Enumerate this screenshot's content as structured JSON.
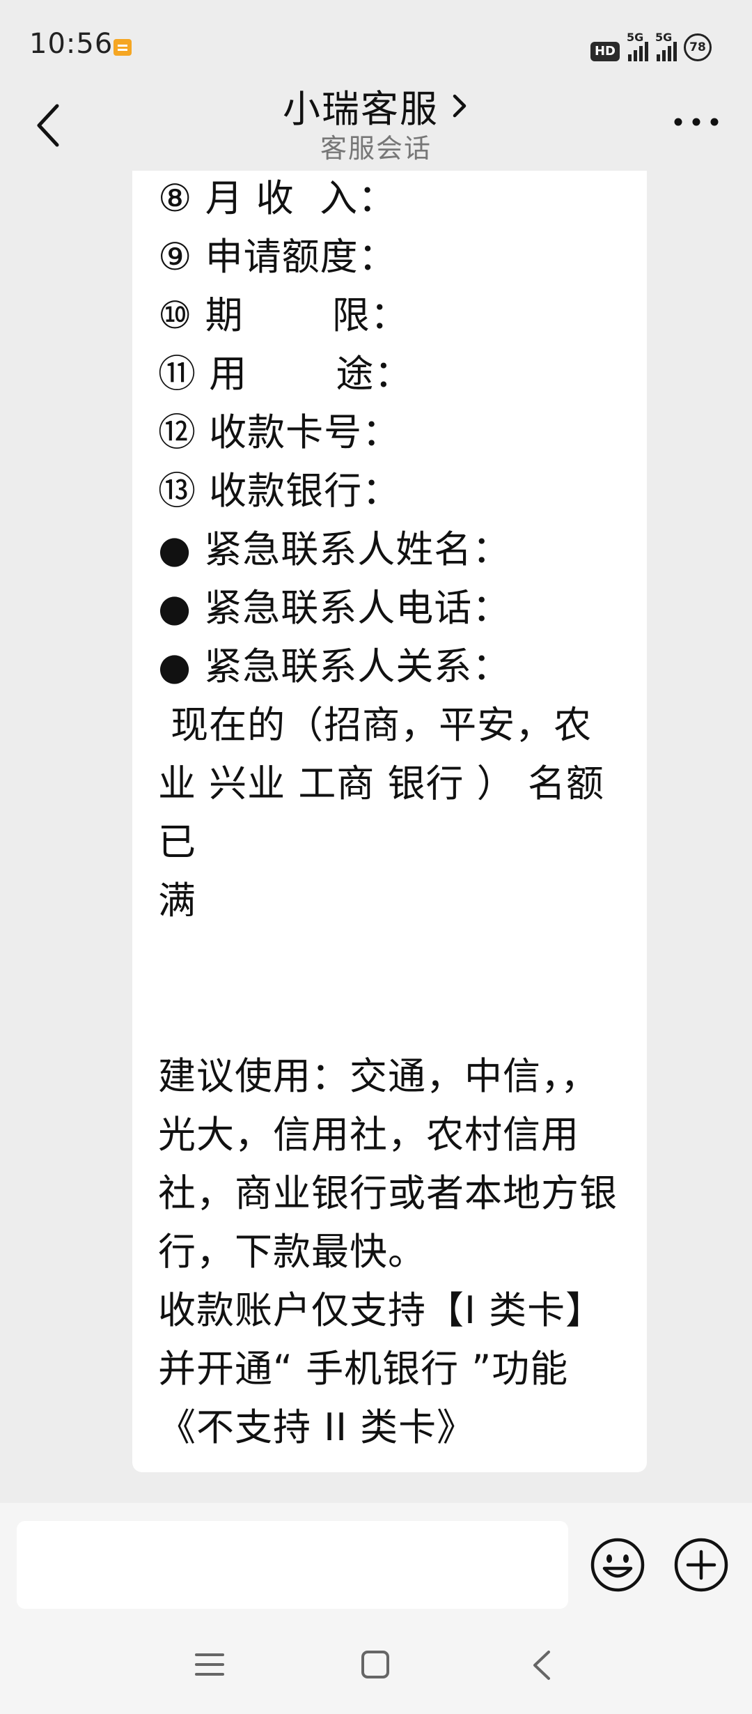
{
  "status_bar": {
    "time": "10:56",
    "hd_label": "HD",
    "network_1": "5G",
    "network_2": "5G",
    "battery": "78"
  },
  "header": {
    "title": "小瑞客服",
    "subtitle": "客服会话"
  },
  "message": {
    "lines": [
      "⑧ 月 收  入：",
      "⑨ 申请额度：",
      "⑩ 期       限：",
      "⑪ 用       途：",
      "⑫ 收款卡号：",
      "⑬ 收款银行：",
      "● 紧急联系人姓名：",
      "● 紧急联系人电话：",
      "● 紧急联系人关系：",
      " 现在的（招商，平安，农",
      "业 兴业 工商 银行 ） 名额",
      "已",
      "满",
      "",
      "",
      "建议使用：交通，中信，，",
      "光大，信用社，农村信用",
      "社，商业银行或者本地方银",
      "行，下款最快。",
      "收款账户仅支持【I 类卡】",
      "并开通“ 手机银行 ”功能",
      "《不支持 II 类卡》"
    ]
  },
  "input": {
    "placeholder": ""
  },
  "icons": {
    "back": "chevron-left-icon",
    "more": "more-dots-icon",
    "emoji": "smiley-icon",
    "plus": "plus-circle-icon"
  },
  "colors": {
    "background": "#ededed",
    "bubble": "#ffffff",
    "input_bar": "#f5f5f5"
  }
}
